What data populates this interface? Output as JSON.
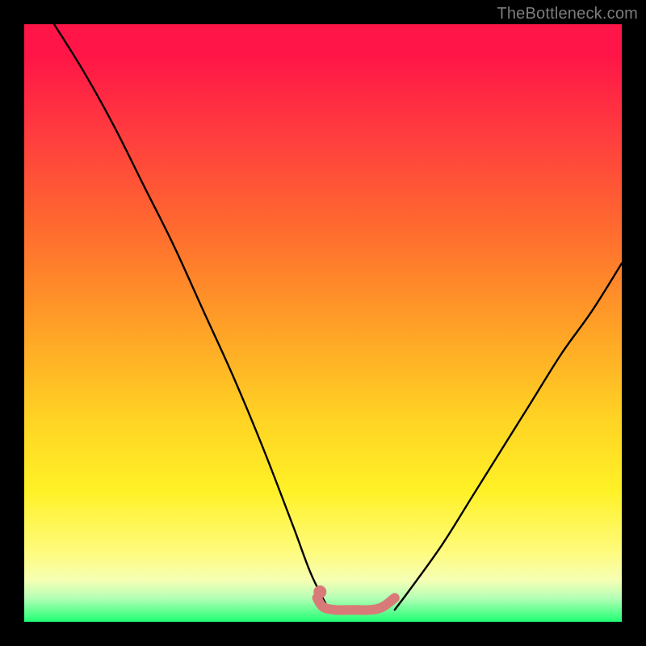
{
  "watermark": "TheBottleneck.com",
  "colors": {
    "frame": "#000000",
    "gradient_top": "#ff1547",
    "gradient_mid1": "#ff6a2f",
    "gradient_mid2": "#ffd324",
    "gradient_mid3": "#fffb7a",
    "gradient_bottom": "#1fff73",
    "curve": "#000000",
    "marker": "#d87a78"
  },
  "chart_data": {
    "type": "line",
    "title": "",
    "xlabel": "",
    "ylabel": "",
    "xlim": [
      0,
      100
    ],
    "ylim": [
      0,
      100
    ],
    "series": [
      {
        "name": "left-branch",
        "x": [
          5,
          10,
          15,
          20,
          25,
          30,
          35,
          40,
          45,
          48,
          51
        ],
        "y": [
          100,
          92,
          83,
          73,
          63,
          52,
          41,
          29,
          16,
          8,
          2
        ]
      },
      {
        "name": "right-branch",
        "x": [
          62,
          65,
          70,
          75,
          80,
          85,
          90,
          95,
          100
        ],
        "y": [
          2,
          6,
          13,
          21,
          29,
          37,
          45,
          52,
          60
        ]
      },
      {
        "name": "bottom-plateau-marker",
        "x": [
          49,
          50,
          52,
          55,
          58,
          60,
          62
        ],
        "y": [
          4,
          2.5,
          2,
          2,
          2,
          2.5,
          4
        ]
      }
    ],
    "annotations": [
      {
        "type": "dot",
        "x": 49.5,
        "y": 5
      }
    ]
  }
}
